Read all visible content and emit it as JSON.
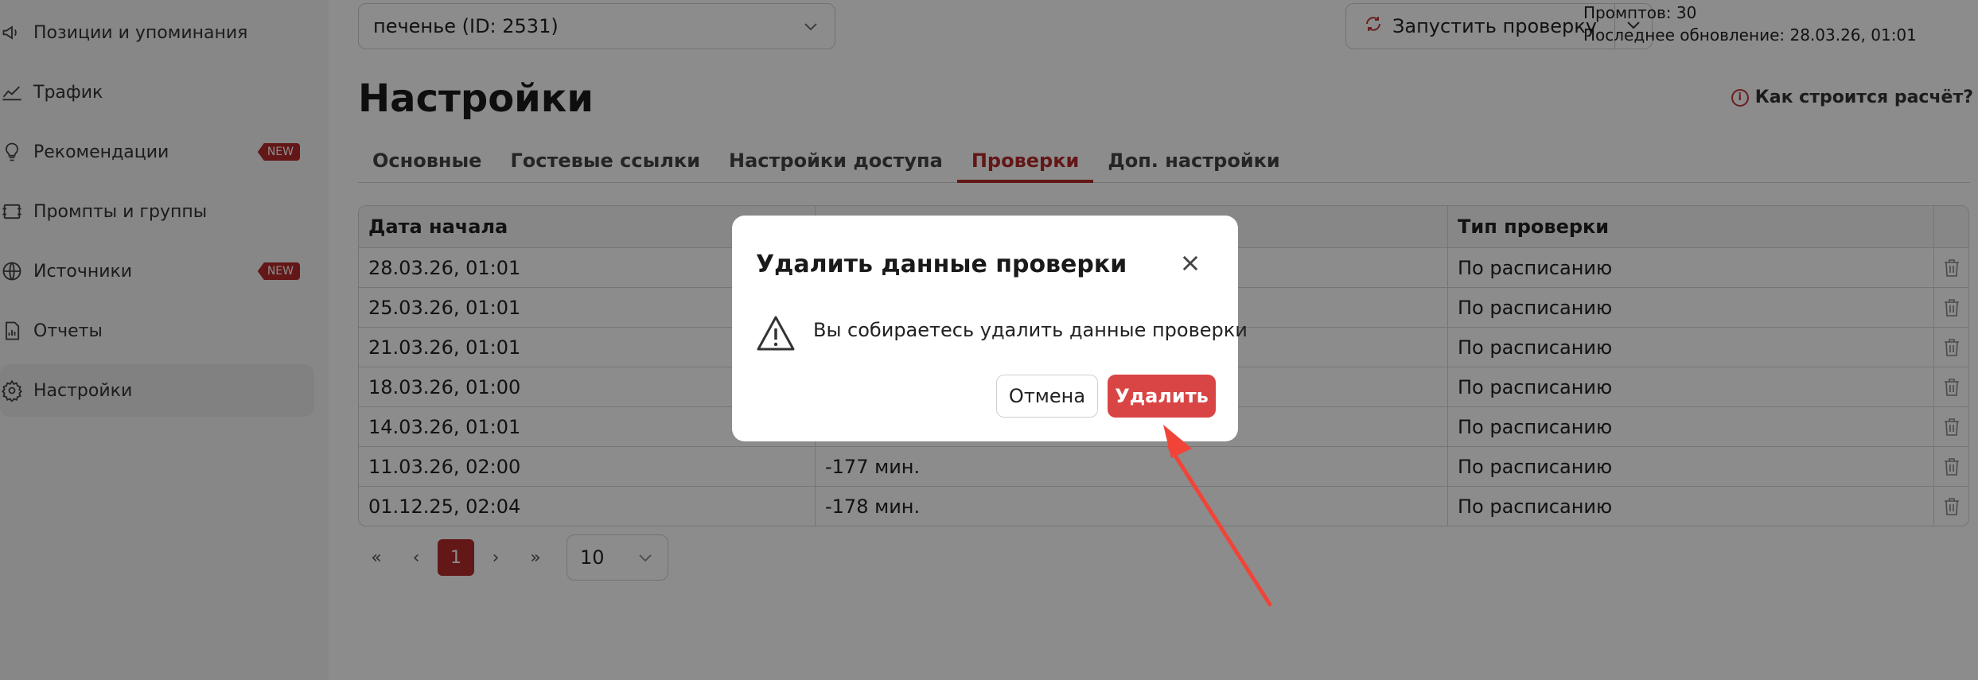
{
  "sidebar": {
    "items": [
      {
        "label": "Позиции и упоминания",
        "icon": "megaphone-icon",
        "badge": ""
      },
      {
        "label": "Трафик",
        "icon": "trend-icon",
        "badge": ""
      },
      {
        "label": "Рекомендации",
        "icon": "lightbulb-icon",
        "badge": "NEW"
      },
      {
        "label": "Промпты и группы",
        "icon": "prompts-icon",
        "badge": ""
      },
      {
        "label": "Источники",
        "icon": "globe-icon",
        "badge": "NEW"
      },
      {
        "label": "Отчеты",
        "icon": "report-icon",
        "badge": ""
      },
      {
        "label": "Настройки",
        "icon": "gear-icon",
        "badge": "",
        "active": true
      }
    ]
  },
  "topbar": {
    "project": "печенье (ID: 2531)",
    "run_label": "Запустить проверку",
    "prompts": "Промптов: 30",
    "updated": "Последнее обновление: 28.03.26, 01:01"
  },
  "page": {
    "title": "Настройки",
    "how_link": "Как строится расчёт?"
  },
  "tabs": [
    {
      "label": "Основные",
      "active": false
    },
    {
      "label": "Гостевые ссылки",
      "active": false
    },
    {
      "label": "Настройки доступа",
      "active": false
    },
    {
      "label": "Проверки",
      "active": true
    },
    {
      "label": "Доп. настройки",
      "active": false
    }
  ],
  "table": {
    "headers": [
      "Дата начала",
      "",
      "Тип проверки"
    ],
    "rows": [
      {
        "date": "28.03.26, 01:01",
        "duration": "",
        "type": "По расписанию"
      },
      {
        "date": "25.03.26, 01:01",
        "duration": "",
        "type": "По расписанию"
      },
      {
        "date": "21.03.26, 01:01",
        "duration": "",
        "type": "По расписанию"
      },
      {
        "date": "18.03.26, 01:00",
        "duration": "",
        "type": "По расписанию"
      },
      {
        "date": "14.03.26, 01:01",
        "duration": "",
        "type": "По расписанию"
      },
      {
        "date": "11.03.26, 02:00",
        "duration": "-177 мин.",
        "type": "По расписанию"
      },
      {
        "date": "01.12.25, 02:04",
        "duration": "-178 мин.",
        "type": "По расписанию"
      }
    ]
  },
  "pagination": {
    "current": "1",
    "page_size": "10"
  },
  "modal": {
    "title": "Удалить данные проверки",
    "message": "Вы собираетесь удалить данные проверки",
    "cancel": "Отмена",
    "confirm": "Удалить"
  },
  "colors": {
    "accent": "#b52a2a",
    "delete_button": "#d94545",
    "arrow": "#f04438"
  }
}
